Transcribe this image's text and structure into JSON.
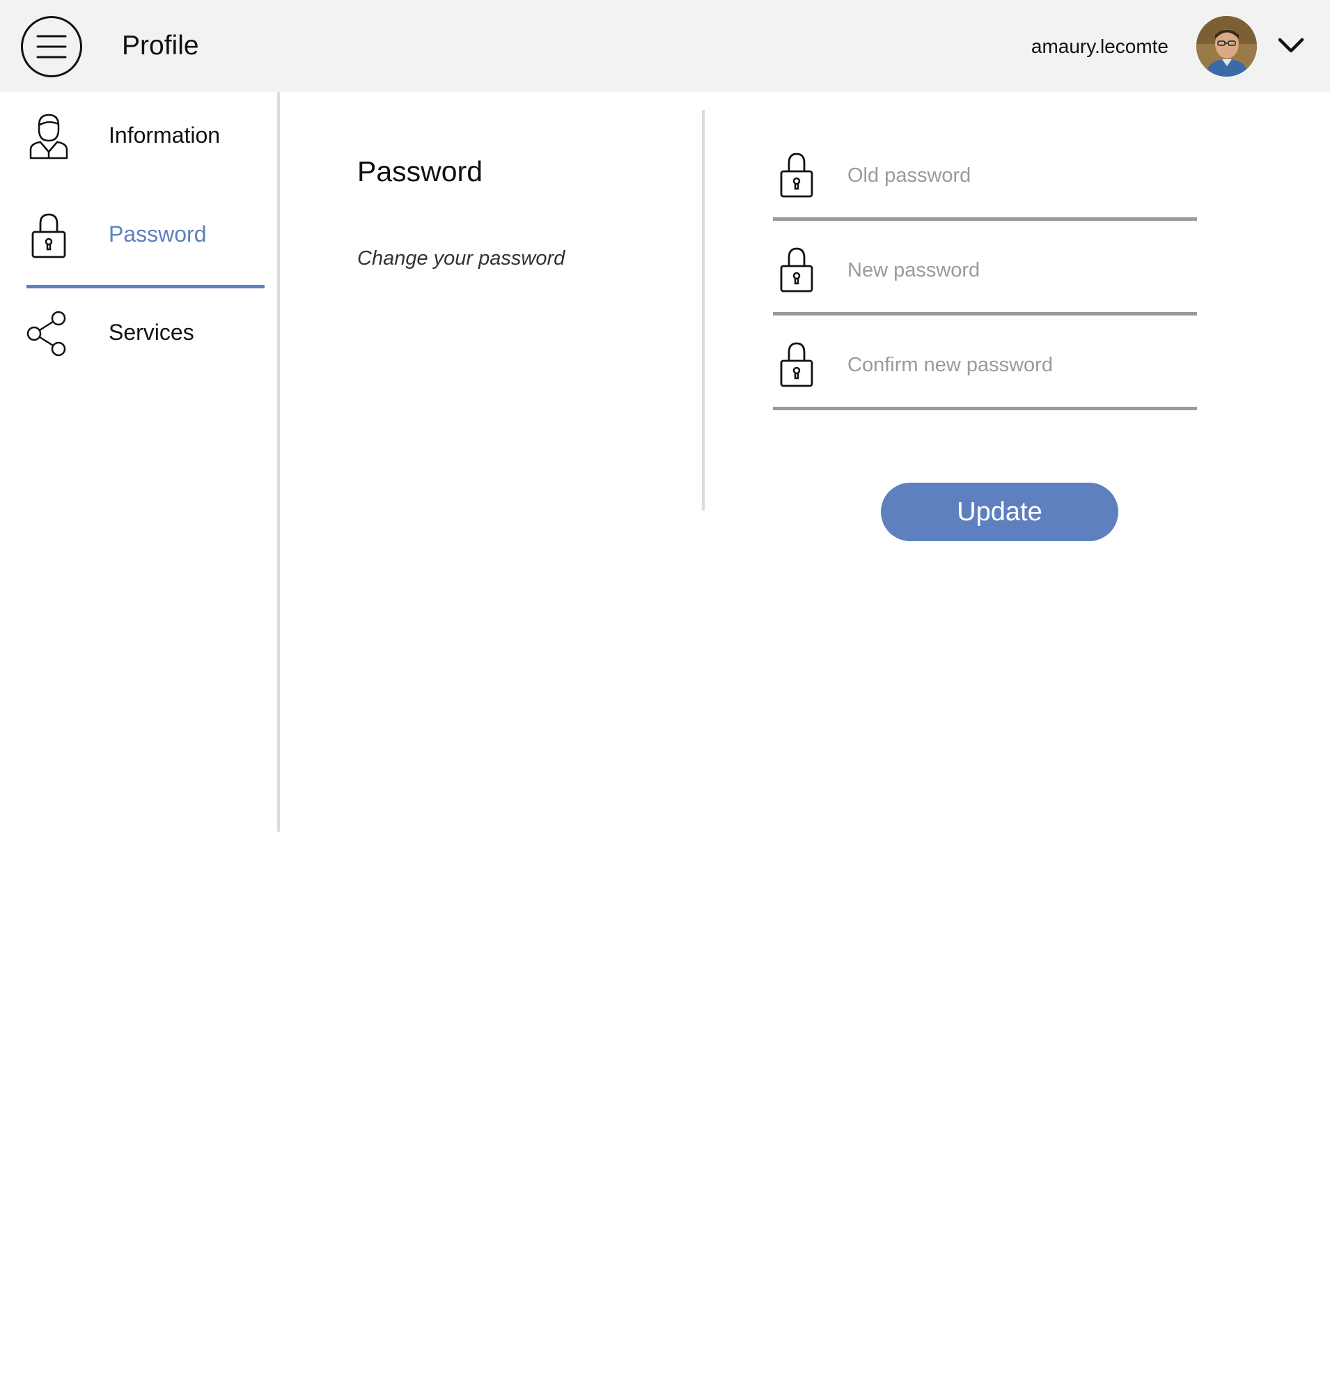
{
  "header": {
    "title": "Profile",
    "username": "amaury.lecomte"
  },
  "sidebar": {
    "items": [
      {
        "label": "Information",
        "icon": "user-icon",
        "active": false
      },
      {
        "label": "Password",
        "icon": "lock-icon",
        "active": true
      },
      {
        "label": "Services",
        "icon": "share-icon",
        "active": false
      }
    ]
  },
  "main": {
    "section_title": "Password",
    "section_subtitle": "Change your password",
    "fields": [
      {
        "placeholder": "Old password",
        "value": "",
        "icon": "lock-icon"
      },
      {
        "placeholder": "New password",
        "value": "",
        "icon": "lock-icon"
      },
      {
        "placeholder": "Confirm new password",
        "value": "",
        "icon": "lock-icon"
      }
    ],
    "update_label": "Update"
  },
  "colors": {
    "accent": "#5e80bf",
    "header_bg": "#f2f2f2",
    "divider": "#dcdcdc",
    "field_underline": "#9a9a9a"
  }
}
